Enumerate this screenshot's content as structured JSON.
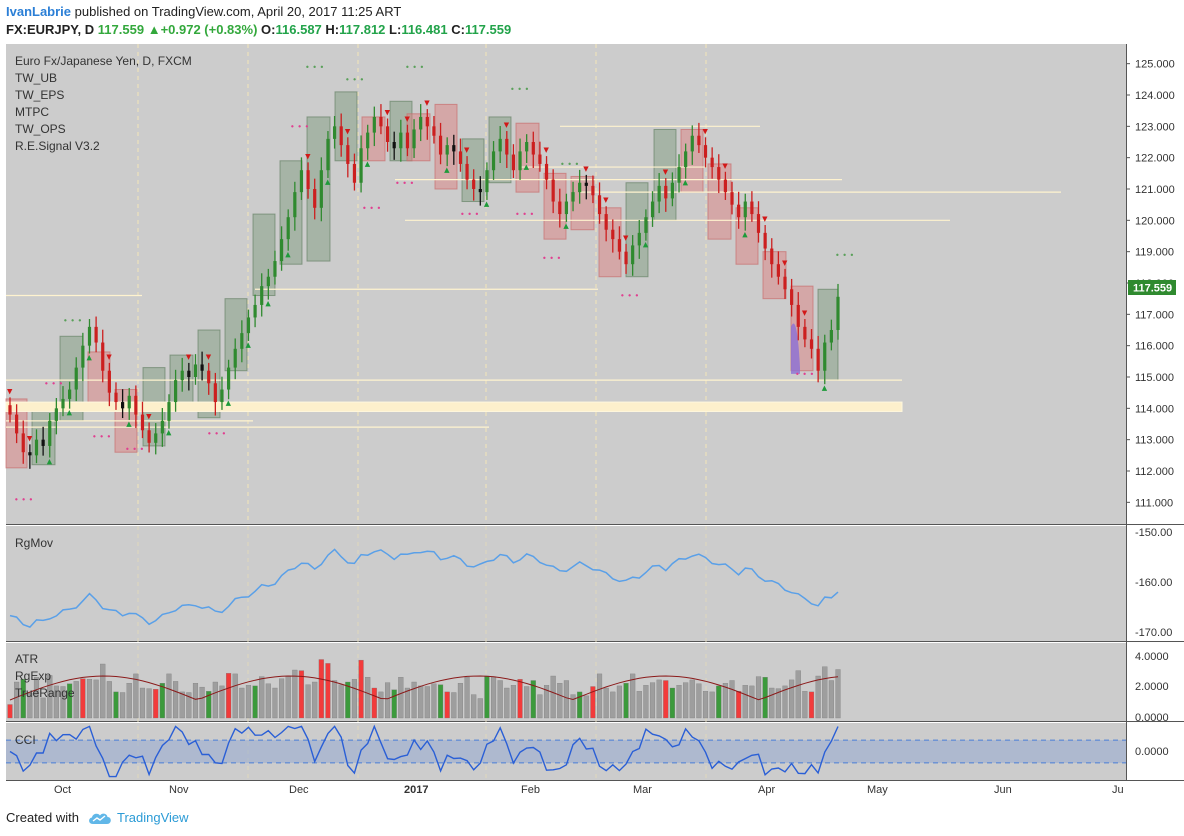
{
  "header": {
    "author": "IvanLabrie",
    "published_text": " published on TradingView.com, April 20, 2017 11:25 ART",
    "symbol": "FX:EURJPY",
    "interval": ", D",
    "last": "117.559",
    "change": "+0.972 (+0.83%)",
    "o_label": "O:",
    "o_value": "116.587",
    "h_label": "H:",
    "h_value": "117.812",
    "l_label": "L:",
    "l_value": "116.481",
    "c_label": "C:",
    "c_value": "117.559"
  },
  "main_pane": {
    "title": "Euro Fx/Japanese Yen, D, FXCM",
    "studies": [
      "TW_UB",
      "TW_EPS",
      "MTPC",
      "TW_OPS",
      "R.E.Signal V3.2"
    ],
    "price_tag": "117.559"
  },
  "panes": {
    "rgmov": {
      "label": "RgMov",
      "ticks": [
        "-150.00",
        "-160.00",
        "-170.00"
      ]
    },
    "atr": {
      "labels": [
        "ATR",
        "RgExp",
        "TrueRange"
      ],
      "ticks": [
        "4.0000",
        "2.0000",
        "0.0000"
      ]
    },
    "cci": {
      "label": "CCI",
      "ticks": [
        "0.0000"
      ]
    }
  },
  "footer": {
    "created_with": "Created with",
    "brand": "TradingView"
  },
  "colors": {
    "background": "#ffffff",
    "pane_bg": "#cccccc",
    "bull": "#2f8a2f",
    "bear": "#cc1f1f",
    "neutral": "#111111",
    "line_blue": "#5aa0e8",
    "atr_red": "#f23b3b",
    "atr_green": "#3c9a3c",
    "atr_gray": "#9e9e9e",
    "rgexp": "#8b1a1a",
    "level": "#fff1c9",
    "price_tag": "#2f8a2f"
  },
  "chart_data": {
    "type": "candlestick",
    "symbol": "FX:EURJPY",
    "x": [
      "Oct",
      "Nov",
      "Dec",
      "2017",
      "Feb",
      "Mar",
      "Apr",
      "May",
      "Jun",
      "Ju"
    ],
    "y_ticks": [
      "125.000",
      "124.000",
      "123.000",
      "122.000",
      "121.000",
      "120.000",
      "119.000",
      "118.000",
      "117.000",
      "116.000",
      "115.000",
      "114.000",
      "113.000",
      "112.000",
      "111.000"
    ],
    "ylim": [
      110.5,
      125.5
    ],
    "last_close": 117.559,
    "closes": [
      113.8,
      113.2,
      112.6,
      112.5,
      113.0,
      112.8,
      113.6,
      114.0,
      114.3,
      114.6,
      115.3,
      116.0,
      116.6,
      116.1,
      115.2,
      114.5,
      114.2,
      114.0,
      114.4,
      113.8,
      113.3,
      112.9,
      113.2,
      113.6,
      114.2,
      114.9,
      115.2,
      115.0,
      115.4,
      115.2,
      114.8,
      114.2,
      114.6,
      115.3,
      115.9,
      116.4,
      116.9,
      117.3,
      117.9,
      118.2,
      118.7,
      119.4,
      120.1,
      120.9,
      121.6,
      121.0,
      120.4,
      121.6,
      122.6,
      123.0,
      122.4,
      121.8,
      121.2,
      122.3,
      122.8,
      123.3,
      123.0,
      122.5,
      122.3,
      122.8,
      122.3,
      122.9,
      123.3,
      123.0,
      122.7,
      122.1,
      122.4,
      122.2,
      121.8,
      121.3,
      121.0,
      120.9,
      121.6,
      122.2,
      122.6,
      122.1,
      121.6,
      122.2,
      122.5,
      122.1,
      121.8,
      121.3,
      120.6,
      120.2,
      120.6,
      120.9,
      121.2,
      121.1,
      120.8,
      120.2,
      119.7,
      119.4,
      119.0,
      118.6,
      119.2,
      119.6,
      120.1,
      120.6,
      121.1,
      120.7,
      121.2,
      121.7,
      122.2,
      122.7,
      122.4,
      122.0,
      121.7,
      121.3,
      120.9,
      120.5,
      120.1,
      120.6,
      120.2,
      119.6,
      119.1,
      118.6,
      118.2,
      117.8,
      117.3,
      116.6,
      116.2,
      115.9,
      115.2,
      116.1,
      116.5,
      117.56
    ],
    "levels": [
      123.0,
      121.7,
      121.3,
      120.9,
      120.0,
      117.8,
      117.6,
      114.9,
      114.0,
      113.6,
      113.4
    ],
    "rgmov": {
      "ticks": [
        -150,
        -160,
        -170
      ],
      "ylim": [
        -172,
        -148
      ]
    },
    "atr": {
      "ticks": [
        4,
        2,
        0
      ],
      "ylim": [
        0,
        4.8
      ]
    },
    "cci": {
      "ticks": [
        0
      ],
      "ylim": [
        -250,
        250
      ],
      "bands": [
        100,
        -100
      ]
    }
  }
}
